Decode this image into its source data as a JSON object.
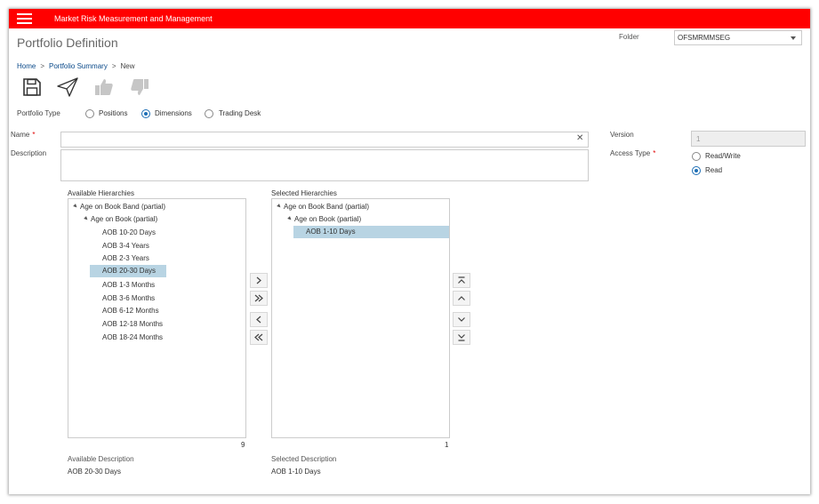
{
  "app": {
    "title": "Market Risk Measurement and Management"
  },
  "page": {
    "title": "Portfolio Definition"
  },
  "folder": {
    "label": "Folder",
    "value": "OFSMRMMSEG"
  },
  "breadcrumb": {
    "home": "Home",
    "summary": "Portfolio Summary",
    "sep1": ">",
    "sep2": ">",
    "current": "New"
  },
  "toolbar": {
    "save_icon": "save-icon",
    "submit_icon": "paper-plane-icon",
    "approve_icon": "thumbs-up-icon",
    "reject_icon": "thumbs-down-icon"
  },
  "portfolio_type": {
    "label": "Portfolio Type",
    "options": [
      "Positions",
      "Dimensions",
      "Trading Desk"
    ],
    "selected": "Dimensions"
  },
  "form": {
    "name_label": "Name",
    "required_mark": "*",
    "description_label": "Description",
    "version_label": "Version",
    "version_value": "1",
    "access_label": "Access Type",
    "access_options": [
      "Read/Write",
      "Read"
    ],
    "access_selected": "Read"
  },
  "available": {
    "title": "Available Hierarchies",
    "root": "Age on Book Band (partial)",
    "child": "Age on Book (partial)",
    "items": [
      "AOB 10-20 Days",
      "AOB 3-4 Years",
      "AOB 2-3 Years",
      "AOB 20-30 Days",
      "AOB 1-3 Months",
      "AOB 3-6 Months",
      "AOB 6-12 Months",
      "AOB 12-18 Months",
      "AOB 18-24 Months"
    ],
    "selected": "AOB 20-30 Days",
    "count": "9",
    "desc_label": "Available Description",
    "desc_value": "AOB 20-30 Days"
  },
  "selected": {
    "title": "Selected Hierarchies",
    "root": "Age on Book Band (partial)",
    "child": "Age on Book (partial)",
    "items": [
      "AOB 1-10 Days"
    ],
    "selected": "AOB 1-10 Days",
    "count": "1",
    "desc_label": "Selected Description",
    "desc_value": "AOB 1-10 Days"
  },
  "colors": {
    "brand": "#ff0000",
    "link": "#0b4a8a",
    "radio": "#1f6fb5",
    "selection": "#b8d4e3"
  }
}
